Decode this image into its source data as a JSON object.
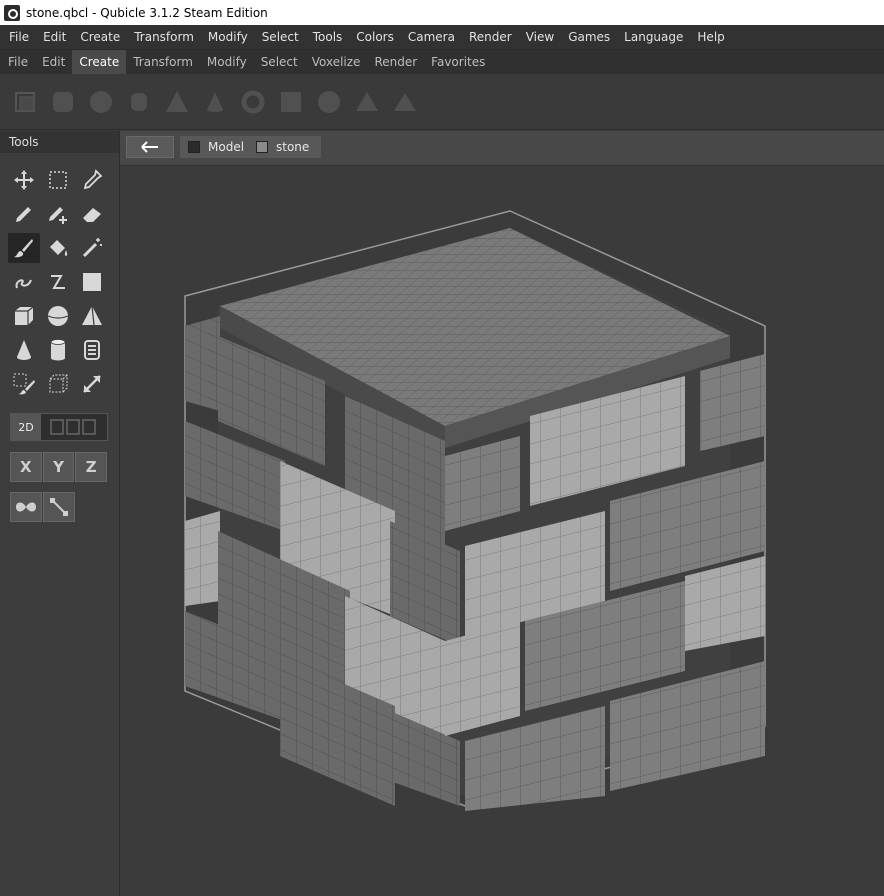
{
  "window": {
    "title": "stone.qbcl - Qubicle 3.1.2 Steam Edition"
  },
  "menu": [
    "File",
    "Edit",
    "Create",
    "Transform",
    "Modify",
    "Select",
    "Tools",
    "Colors",
    "Camera",
    "Render",
    "View",
    "Games",
    "Language",
    "Help"
  ],
  "submenu": {
    "items": [
      "File",
      "Edit",
      "Create",
      "Transform",
      "Modify",
      "Select",
      "Voxelize",
      "Render",
      "Favorites"
    ],
    "active": "Create"
  },
  "shape_icons": [
    "cube-icon",
    "rounded-cube-icon",
    "sphere-icon",
    "cylinder-icon",
    "pyramid-icon",
    "cone-icon",
    "torus-icon",
    "plane-icon",
    "dome-icon",
    "prism-icon",
    "wedge-icon"
  ],
  "tools_panel": {
    "title": "Tools",
    "tools": [
      "move-icon",
      "select-rect-icon",
      "eyedropper-icon",
      "pencil-icon",
      "pencil-add-icon",
      "eraser-icon",
      "brush-icon",
      "paint-bucket-icon",
      "magic-wand-icon",
      "curve-icon",
      "line-icon",
      "rect-fill-icon",
      "box-icon",
      "sphere-icon",
      "pyramid-icon",
      "cone-icon",
      "cylinder-icon",
      "layers-icon",
      "select-paint-icon",
      "wire-cube-icon",
      "resize-icon"
    ],
    "selected_tool": "brush-icon",
    "mode_label": "2D",
    "axes": [
      "X",
      "Y",
      "Z"
    ]
  },
  "viewport": {
    "breadcrumbs": [
      {
        "label": "Model",
        "color": "#2b2b2b"
      },
      {
        "label": "stone",
        "color": "#8a8a8a"
      }
    ]
  },
  "colors": {
    "stone_light": "#a9a9a9",
    "stone_mid": "#808080",
    "stone_dark": "#5e5e5e",
    "mortar": "#3f3f3f",
    "bounding_box": "#9a9a9a"
  }
}
